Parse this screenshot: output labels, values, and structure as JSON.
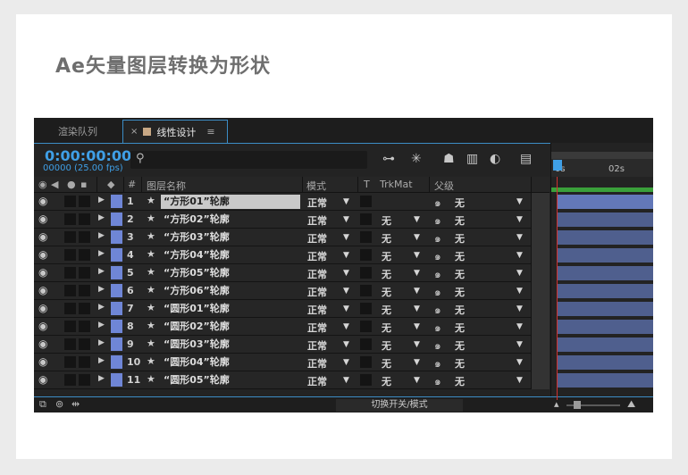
{
  "title": "Ae矢量图层转换为形状",
  "tabs": {
    "render_queue": "渲染队列",
    "composition": "线性设计",
    "close": "×",
    "menu": "≡"
  },
  "comp": {
    "timecode": "0:00:00:00",
    "frames": "00000 (25.00 fps)"
  },
  "columns": {
    "num": "#",
    "layer_name": "图层名称",
    "mode": "模式",
    "t": "T",
    "trkmat": "TrkMat",
    "parent": "父级"
  },
  "ruler": {
    "t0": "0s",
    "t2": "02s"
  },
  "layers": [
    {
      "num": "1",
      "name": "“方形01”轮廓",
      "mode": "正常",
      "trkmat": "",
      "parent": "无"
    },
    {
      "num": "2",
      "name": "“方形02”轮廓",
      "mode": "正常",
      "trkmat": "无",
      "parent": "无"
    },
    {
      "num": "3",
      "name": "“方形03”轮廓",
      "mode": "正常",
      "trkmat": "无",
      "parent": "无"
    },
    {
      "num": "4",
      "name": "“方形04”轮廓",
      "mode": "正常",
      "trkmat": "无",
      "parent": "无"
    },
    {
      "num": "5",
      "name": "“方形05”轮廓",
      "mode": "正常",
      "trkmat": "无",
      "parent": "无"
    },
    {
      "num": "6",
      "name": "“方形06”轮廓",
      "mode": "正常",
      "trkmat": "无",
      "parent": "无"
    },
    {
      "num": "7",
      "name": "“圆形01”轮廓",
      "mode": "正常",
      "trkmat": "无",
      "parent": "无"
    },
    {
      "num": "8",
      "name": "“圆形02”轮廓",
      "mode": "正常",
      "trkmat": "无",
      "parent": "无"
    },
    {
      "num": "9",
      "name": "“圆形03”轮廓",
      "mode": "正常",
      "trkmat": "无",
      "parent": "无"
    },
    {
      "num": "10",
      "name": "“圆形04”轮廓",
      "mode": "正常",
      "trkmat": "无",
      "parent": "无"
    },
    {
      "num": "11",
      "name": "“圆形05”轮廓",
      "mode": "正常",
      "trkmat": "无",
      "parent": "无"
    }
  ],
  "status": {
    "toggle_label": "切换开关/模式"
  },
  "colors": {
    "accent": "#3f9fe6",
    "label": "#6f86d6",
    "playhead": "#d0302f",
    "layer_bar": "#4f5f8e"
  }
}
